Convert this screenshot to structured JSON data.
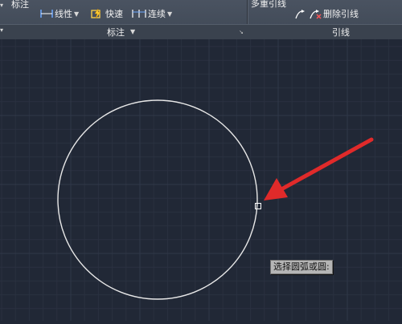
{
  "ribbon": {
    "annotation_panel_top_label": "标注",
    "tools": {
      "linear_label": "线性",
      "quick_label": "快速",
      "continue_label": "连续"
    },
    "annotation_panel_title": "标注",
    "multileader_label": "多重引线",
    "delete_leader_label": "删除引线",
    "leader_panel_title": "引线"
  },
  "canvas": {
    "prompt_tooltip": "选择圆弧或圆:",
    "colors": {
      "background": "#212836",
      "grid_minor": "#2a3140",
      "grid_major": "#303848",
      "circle": "#e8e8e8",
      "arrow": "#e02a2a"
    }
  }
}
